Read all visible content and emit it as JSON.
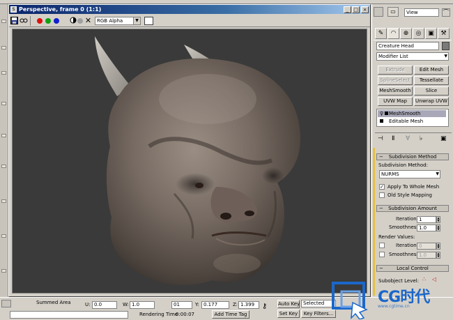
{
  "render_window": {
    "title": "Perspective, frame 0 (1:1)",
    "channel": "RGB Alpha",
    "colors": {
      "red": "#e01010",
      "green": "#10a010",
      "blue": "#1020d0",
      "mono": "#404040",
      "alpha": "#a0a0a0"
    }
  },
  "command_panel": {
    "view_label": "View",
    "object_name": "Creature Head",
    "object_color": "#7a7a7a",
    "modifier_list": "Modifier List",
    "buttons": [
      {
        "label": "Extrude",
        "enabled": false
      },
      {
        "label": "Edit Mesh",
        "enabled": true
      },
      {
        "label": "SplineSelect",
        "enabled": false
      },
      {
        "label": "Tessellate",
        "enabled": true
      },
      {
        "label": "MeshSmooth",
        "enabled": true
      },
      {
        "label": "Slice",
        "enabled": true
      },
      {
        "label": "UVW Map",
        "enabled": true
      },
      {
        "label": "Unwrap UVW",
        "enabled": true
      }
    ],
    "stack": [
      {
        "label": "MeshSmooth",
        "selected": true
      },
      {
        "label": "Editable Mesh",
        "selected": false
      }
    ],
    "subdivision_method": {
      "header": "Subdivision Method",
      "method_label": "Subdivision Method:",
      "method_value": "NURMS",
      "apply_whole_mesh": "Apply To Whole Mesh",
      "apply_checked": true,
      "old_style": "Old Style Mapping",
      "old_checked": false
    },
    "subdivision_amount": {
      "header": "Subdivision Amount",
      "iterations_label": "Iterations:",
      "iterations": "1",
      "smoothness_label": "Smoothness:",
      "smoothness": "1.0",
      "render_values": "Render Values:",
      "r_iterations_label": "Iterations:",
      "r_iterations": "0",
      "r_smoothness_label": "Smoothness:",
      "r_smoothness": "1.0"
    },
    "local_control": {
      "header": "Local Control",
      "subobject_label": "Subobject Level:"
    }
  },
  "status_bar": {
    "area_label": "Summed Area",
    "u_label": "U:",
    "u_value": "0.0",
    "w_label": "W:",
    "w_value": "1.0",
    "frame_value": "01",
    "y_label": "Y:",
    "y_value": "0.177",
    "z_label": "Z:",
    "z_value": "1.399",
    "auto_key": "Auto Key",
    "selected": "Selected",
    "set_key": "Set Key",
    "key_filters": "Key Filters...",
    "rendering_time_label": "Rendering Time",
    "rendering_time": "0:00:07",
    "add_time_tag": "Add Time Tag"
  },
  "watermark": {
    "brand": "CG时代",
    "sub": "www.cgtime.cn"
  }
}
